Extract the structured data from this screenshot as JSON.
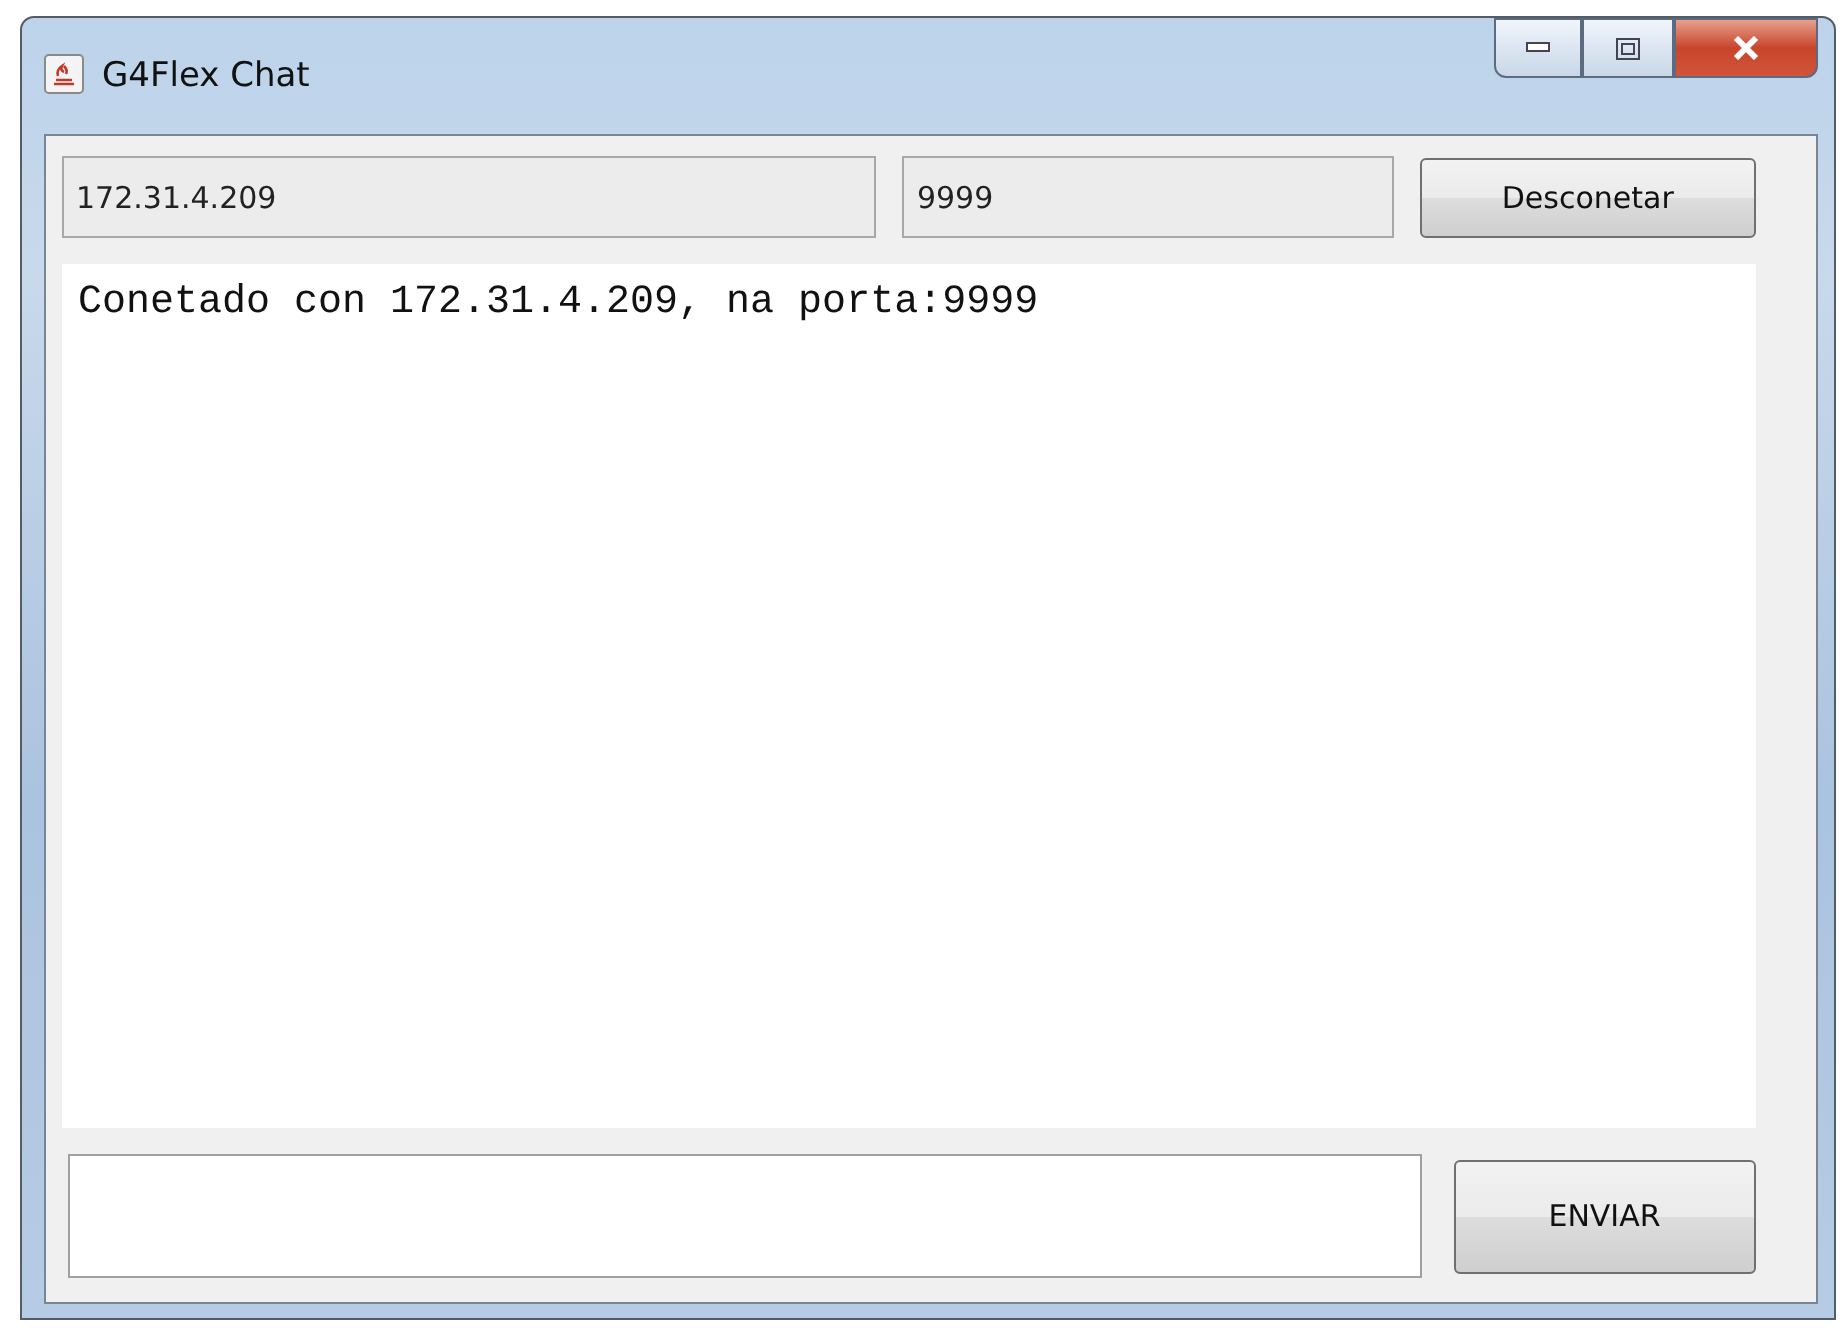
{
  "window": {
    "title": "G4Flex Chat"
  },
  "connection": {
    "host": {
      "value": "172.31.4.209",
      "disabled": true
    },
    "port": {
      "value": "9999",
      "disabled": true
    },
    "button": "Desconetar"
  },
  "log": [
    "Conetado con 172.31.4.209, na porta:9999"
  ],
  "send_button": "ENVIAR"
}
